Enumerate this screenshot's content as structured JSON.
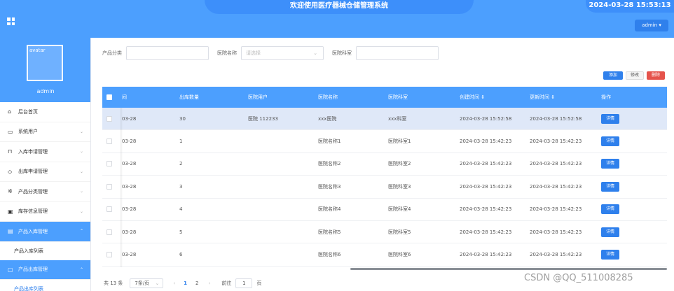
{
  "header": {
    "title": "欢迎使用医疗器械仓储管理系统",
    "datetime": "2024-03-28 15:53:13",
    "admin_label": "admin ▾"
  },
  "sidebar": {
    "avatar_alt": "avatar",
    "username": "admin",
    "items": [
      {
        "label": "后台首页",
        "icon": "home-icon",
        "glyph": "⌂",
        "chevron": ""
      },
      {
        "label": "系统用户",
        "icon": "monitor-icon",
        "glyph": "▭",
        "chevron": "⌄"
      },
      {
        "label": "入库申请管理",
        "icon": "bookmark-icon",
        "glyph": "⊓",
        "chevron": "⌄"
      },
      {
        "label": "出库申请管理",
        "icon": "tag-icon",
        "glyph": "◇",
        "chevron": "⌄"
      },
      {
        "label": "产品分类管理",
        "icon": "gear-icon",
        "glyph": "✲",
        "chevron": "⌄"
      },
      {
        "label": "库存信息管理",
        "icon": "box-icon",
        "glyph": "▣",
        "chevron": "⌄"
      },
      {
        "label": "产品入库管理",
        "icon": "document-icon",
        "glyph": "▤",
        "chevron": "⌃"
      },
      {
        "label": "产品入库列表",
        "sub": true
      },
      {
        "label": "产品出库管理",
        "icon": "chat-icon",
        "glyph": "▢",
        "chevron": "⌃"
      },
      {
        "label": "产品出库列表",
        "sub": true
      }
    ]
  },
  "filter": {
    "category_label": "产品分类",
    "category_value": "",
    "hospital_label": "医院名称",
    "hospital_placeholder": "请选择",
    "dept_label": "医院科室",
    "dept_value": ""
  },
  "actions": {
    "add": "添加",
    "edit": "修改",
    "delete": "删除"
  },
  "table": {
    "headers": [
      "间",
      "出库数量",
      "医院用户",
      "医院名称",
      "医院科室",
      "创建时间 ⇕",
      "更新时间 ⇕",
      "操作"
    ],
    "detail_label": "详情",
    "rows": [
      [
        "03-28",
        "30",
        "医院 112233",
        "xxx医院",
        "xxx科室",
        "2024-03-28 15:52:58",
        "2024-03-28 15:52:58"
      ],
      [
        "03-28",
        "1",
        "",
        "医院名称1",
        "医院科室1",
        "2024-03-28 15:42:23",
        "2024-03-28 15:42:23"
      ],
      [
        "03-28",
        "2",
        "",
        "医院名称2",
        "医院科室2",
        "2024-03-28 15:42:23",
        "2024-03-28 15:42:23"
      ],
      [
        "03-28",
        "3",
        "",
        "医院名称3",
        "医院科室3",
        "2024-03-28 15:42:23",
        "2024-03-28 15:42:23"
      ],
      [
        "03-28",
        "4",
        "",
        "医院名称4",
        "医院科室4",
        "2024-03-28 15:42:23",
        "2024-03-28 15:42:23"
      ],
      [
        "03-28",
        "5",
        "",
        "医院名称5",
        "医院科室5",
        "2024-03-28 15:42:23",
        "2024-03-28 15:42:23"
      ],
      [
        "03-28",
        "6",
        "",
        "医院名称6",
        "医院科室6",
        "2024-03-28 15:42:23",
        "2024-03-28 15:42:23"
      ]
    ]
  },
  "pager": {
    "total": "共 13 条",
    "page_size": "7条/页",
    "prev": "‹",
    "pages": [
      "1",
      "2"
    ],
    "current": "1",
    "next": "›",
    "goto_label": "前往",
    "goto_value": "1",
    "page_unit": "页"
  },
  "watermark": "CSDN @QQ_511008285"
}
